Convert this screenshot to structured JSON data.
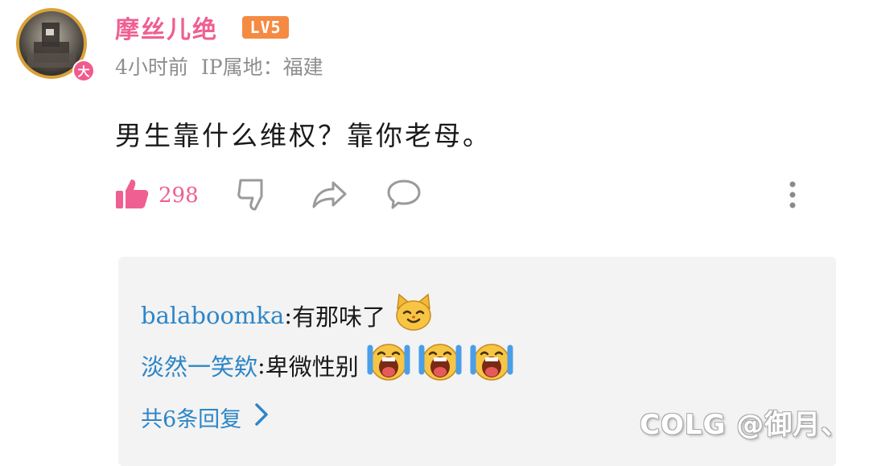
{
  "comment": {
    "author": "摩丝儿绝",
    "level_badge": "LV5",
    "avatar_badge": "大",
    "time": "4小时前",
    "ip_location": "IP属地：福建",
    "text": "男生靠什么维权？靠你老母。",
    "like_count": "298",
    "accent_color": "#ef5f92"
  },
  "actions": {
    "icons": [
      "thumbs-up-icon",
      "thumbs-down-icon",
      "share-icon",
      "comment-icon",
      "more-vertical-icon"
    ]
  },
  "replies": [
    {
      "user": "balaboomka",
      "separator": ": ",
      "text": "有那味了",
      "emojis": [
        "cat-emoji"
      ]
    },
    {
      "user": "淡然一笑欸",
      "separator": ": ",
      "text": "卑微性别",
      "emojis": [
        "crying-emoji",
        "crying-emoji",
        "crying-emoji"
      ]
    }
  ],
  "more_replies_label": "共6条回复",
  "watermark": "COLG @御月、",
  "colors": {
    "link": "#2d86c7",
    "level_badge": "#f58a43",
    "reply_bg": "#f3f3f3"
  }
}
